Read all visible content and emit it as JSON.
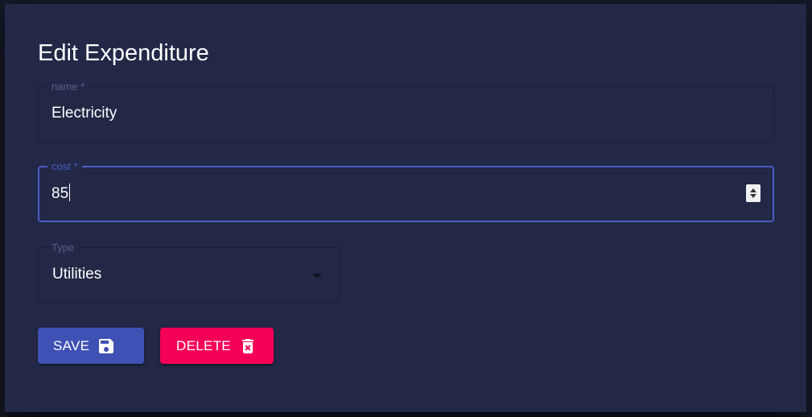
{
  "dialog": {
    "title": "Edit Expenditure"
  },
  "form": {
    "name": {
      "label": "name *",
      "value": "Electricity"
    },
    "cost": {
      "label": "cost *",
      "value": "85"
    },
    "type": {
      "label": "Type",
      "value": "Utilities"
    }
  },
  "actions": {
    "save_label": "SAVE",
    "save_icon": "save-icon",
    "delete_label": "DELETE",
    "delete_icon": "delete-forever-icon"
  },
  "colors": {
    "dialog_background": "#222846",
    "focus_accent": "#4b5bc4",
    "save_button": "#3f51b5",
    "delete_button": "#f50057"
  }
}
